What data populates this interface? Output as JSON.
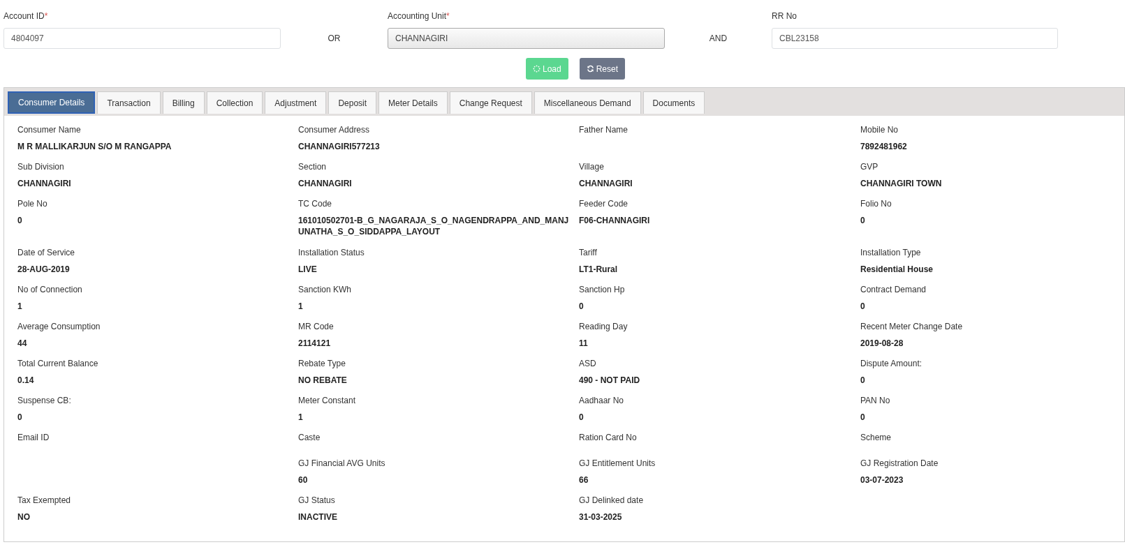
{
  "search": {
    "fields": [
      {
        "kind": "text",
        "label": "Account ID",
        "required_mark": "*",
        "value": "4804097"
      },
      {
        "kind": "connector",
        "label": "OR"
      },
      {
        "kind": "select",
        "label": "Accounting Unit",
        "required_mark": "*",
        "value": "CHANNAGIRI"
      },
      {
        "kind": "connector",
        "label": "AND"
      },
      {
        "kind": "text",
        "label": "RR No",
        "value": "CBL23158"
      }
    ],
    "buttons": [
      {
        "kind": "load",
        "label": "Load",
        "loading": true
      },
      {
        "kind": "reset",
        "label": "Reset",
        "loading": false
      }
    ]
  },
  "tabs": [
    {
      "label": "Consumer Details",
      "selected": true
    },
    {
      "label": "Transaction",
      "selected": false
    },
    {
      "label": "Billing",
      "selected": false
    },
    {
      "label": "Collection",
      "selected": false
    },
    {
      "label": "Adjustment",
      "selected": false
    },
    {
      "label": "Deposit",
      "selected": false
    },
    {
      "label": "Meter Details",
      "selected": false
    },
    {
      "label": "Change Request",
      "selected": false
    },
    {
      "label": "Miscellaneous Demand",
      "selected": false
    },
    {
      "label": "Documents",
      "selected": false
    }
  ],
  "details": {
    "rows": [
      {
        "cells": [
          {
            "kind": "field",
            "label": "Consumer Name",
            "value": "M R MALLIKARJUN S/O M RANGAPPA"
          },
          {
            "kind": "field",
            "label": "Consumer Address",
            "value": "CHANNAGIRI577213"
          },
          {
            "kind": "field",
            "label": "Father Name"
          },
          {
            "kind": "field",
            "label": "Mobile No",
            "value": "7892481962"
          }
        ]
      },
      {
        "cells": [
          {
            "kind": "field",
            "label": "Sub Division",
            "value": "CHANNAGIRI"
          },
          {
            "kind": "field",
            "label": "Section",
            "value": "CHANNAGIRI"
          },
          {
            "kind": "field",
            "label": "Village",
            "value": "CHANNAGIRI"
          },
          {
            "kind": "field",
            "label": "GVP",
            "value": "CHANNAGIRI TOWN"
          }
        ]
      },
      {
        "cells": [
          {
            "kind": "field",
            "label": "Pole No",
            "value": "0"
          },
          {
            "kind": "field",
            "label": "TC Code",
            "value": "161010502701-B_G_NAGARAJA_S_O_NAGENDRAPPA_AND_MANJUNATHA_S_O_SIDDAPPA_LAYOUT"
          },
          {
            "kind": "field",
            "label": "Feeder Code",
            "value": "F06-CHANNAGIRI"
          },
          {
            "kind": "field",
            "label": "Folio No",
            "value": "0"
          }
        ]
      },
      {
        "cells": [
          {
            "kind": "field",
            "label": "Date of Service",
            "value": "28-AUG-2019"
          },
          {
            "kind": "field",
            "label": "Installation Status",
            "value": "LIVE"
          },
          {
            "kind": "field",
            "label": "Tariff",
            "value": "LT1-Rural"
          },
          {
            "kind": "field",
            "label": "Installation Type",
            "value": "Residential House"
          }
        ]
      },
      {
        "cells": [
          {
            "kind": "field",
            "label": "No of Connection",
            "value": "1"
          },
          {
            "kind": "field",
            "label": "Sanction KWh",
            "value": "1"
          },
          {
            "kind": "field",
            "label": "Sanction Hp",
            "value": "0"
          },
          {
            "kind": "field",
            "label": "Contract Demand",
            "value": "0"
          }
        ]
      },
      {
        "cells": [
          {
            "kind": "field",
            "label": "Average Consumption",
            "value": "44"
          },
          {
            "kind": "field",
            "label": "MR Code",
            "value": "2114121"
          },
          {
            "kind": "field",
            "label": "Reading Day",
            "value": "11"
          },
          {
            "kind": "field",
            "label": "Recent Meter Change Date",
            "value": "2019-08-28"
          }
        ]
      },
      {
        "cells": [
          {
            "kind": "field",
            "label": "Total Current Balance",
            "value": "0.14"
          },
          {
            "kind": "field",
            "label": "Rebate Type",
            "value": "NO REBATE"
          },
          {
            "kind": "field",
            "label": "ASD",
            "value": "490 - NOT PAID"
          },
          {
            "kind": "field",
            "label": "Dispute Amount:",
            "value": "0"
          }
        ]
      },
      {
        "cells": [
          {
            "kind": "field",
            "label": "Suspense CB:",
            "value": "0"
          },
          {
            "kind": "field",
            "label": "Meter Constant",
            "value": "1"
          },
          {
            "kind": "field",
            "label": "Aadhaar No",
            "value": "0"
          },
          {
            "kind": "field",
            "label": "PAN No",
            "value": "0"
          }
        ]
      },
      {
        "cells": [
          {
            "kind": "field",
            "label": "Email ID"
          },
          {
            "kind": "field",
            "label": "Caste"
          },
          {
            "kind": "field",
            "label": "Ration Card No"
          },
          {
            "kind": "field",
            "label": "Scheme"
          }
        ]
      },
      {
        "cells": [
          {
            "kind": "blank"
          },
          {
            "kind": "field",
            "label": "GJ Financial AVG Units",
            "value": "60"
          },
          {
            "kind": "field",
            "label": "GJ Entitlement Units",
            "value": "66"
          },
          {
            "kind": "field",
            "label": "GJ Registration Date",
            "value": "03-07-2023"
          }
        ]
      },
      {
        "cells": [
          {
            "kind": "field",
            "label": "Tax Exempted",
            "value": "NO"
          },
          {
            "kind": "field",
            "label": "GJ Status",
            "value": "INACTIVE"
          },
          {
            "kind": "field",
            "label": "GJ Delinked date",
            "value": "31-03-2025"
          },
          {
            "kind": "blank"
          }
        ]
      }
    ]
  }
}
